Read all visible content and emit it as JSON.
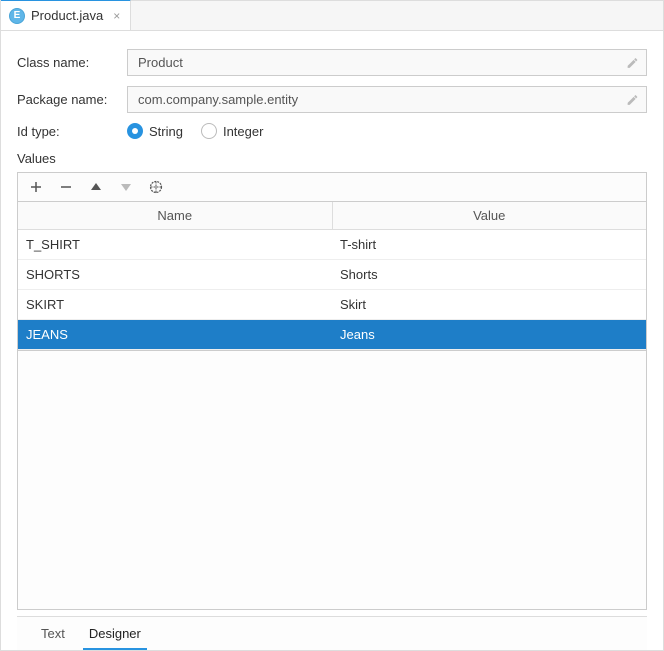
{
  "tab": {
    "title": "Product.java",
    "icon_letter": "E"
  },
  "form": {
    "class_label": "Class name:",
    "class_value": "Product",
    "package_label": "Package name:",
    "package_value": "com.company.sample.entity",
    "id_type_label": "Id type:",
    "id_options": {
      "string": "String",
      "integer": "Integer"
    },
    "values_label": "Values"
  },
  "table": {
    "headers": {
      "name": "Name",
      "value": "Value"
    },
    "rows": [
      {
        "name": "T_SHIRT",
        "value": "T-shirt",
        "selected": false
      },
      {
        "name": "SHORTS",
        "value": "Shorts",
        "selected": false
      },
      {
        "name": "SKIRT",
        "value": "Skirt",
        "selected": false
      },
      {
        "name": "JEANS",
        "value": "Jeans",
        "selected": true
      }
    ]
  },
  "bottom_tabs": {
    "text": "Text",
    "designer": "Designer"
  }
}
